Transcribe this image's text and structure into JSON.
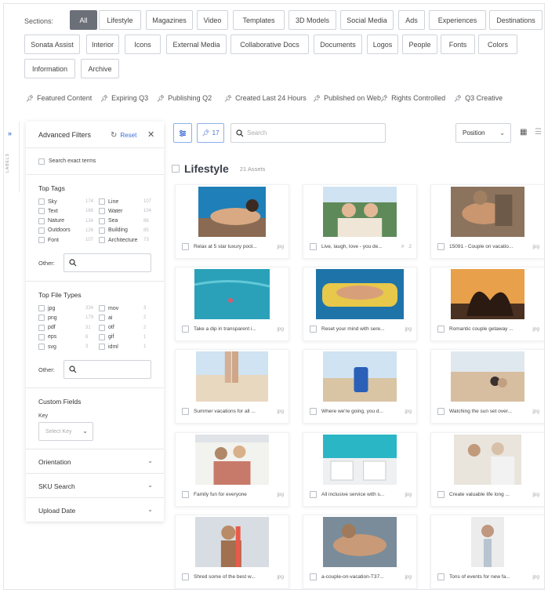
{
  "sections": {
    "label": "Sections:",
    "chips": [
      "All",
      "Lifestyle",
      "Magazines",
      "Video",
      "Templates",
      "3D Models",
      "Social Media",
      "Ads",
      "Experiences",
      "Destinations",
      "Sonata Assist",
      "Interior",
      "Icons",
      "External Media",
      "Collaborative Docs",
      "Documents",
      "Logos",
      "People",
      "Fonts",
      "Colors",
      "Information",
      "Archive"
    ]
  },
  "quick_filters": [
    "Featured Content",
    "Expiring Q3",
    "Publishing Q2",
    "Created Last 24 Hours",
    "Published on Web",
    "Rights Controlled",
    "Q3 Creative"
  ],
  "side_strip": {
    "label": "LABELS"
  },
  "filters": {
    "title": "Advanced Filters",
    "reset": "Reset",
    "exact": "Search exact terms",
    "top_tags": {
      "title": "Top Tags",
      "items": [
        {
          "name": "Sky",
          "count": "174"
        },
        {
          "name": "Line",
          "count": "107"
        },
        {
          "name": "Text",
          "count": "168"
        },
        {
          "name": "Water",
          "count": "104"
        },
        {
          "name": "Nature",
          "count": "134"
        },
        {
          "name": "Sea",
          "count": "86"
        },
        {
          "name": "Outdoors",
          "count": "126"
        },
        {
          "name": "Building",
          "count": "85"
        },
        {
          "name": "Font",
          "count": "107"
        },
        {
          "name": "Architecture",
          "count": "73"
        }
      ],
      "other": "Other:"
    },
    "file_types": {
      "title": "Top File Types",
      "items": [
        {
          "name": "jpg",
          "count": "334"
        },
        {
          "name": "mov",
          "count": "3"
        },
        {
          "name": "png",
          "count": "179"
        },
        {
          "name": "ai",
          "count": "2"
        },
        {
          "name": "pdf",
          "count": "31"
        },
        {
          "name": "otf",
          "count": "2"
        },
        {
          "name": "eps",
          "count": "6"
        },
        {
          "name": "gif",
          "count": "1"
        },
        {
          "name": "svg",
          "count": "3"
        },
        {
          "name": "idml",
          "count": "1"
        }
      ],
      "other": "Other:"
    },
    "custom_fields": {
      "title": "Custom Fields",
      "key_label": "Key",
      "key_placeholder": "Select Key"
    },
    "collapsed": [
      "Orientation",
      "SKU Search",
      "Upload Date"
    ]
  },
  "toolbar": {
    "label_count": "17",
    "search_placeholder": "Search",
    "sort": "Position"
  },
  "heading": {
    "title": "Lifestyle",
    "count": "21 Assets"
  },
  "cards": [
    {
      "name": "Relax at 5 star luxury pool...",
      "ext": "jpg",
      "extra": "",
      "scene": "pool"
    },
    {
      "name": "Live, laugh, love - you de...",
      "ext": "",
      "extra": "2",
      "scene": "friends"
    },
    {
      "name": "15091 - Couple on vacatio...",
      "ext": "jpg",
      "extra": "",
      "scene": "couple"
    },
    {
      "name": "Take a dip in transparent i...",
      "ext": "jpg",
      "extra": "",
      "scene": "water"
    },
    {
      "name": "Reset your mind with sere...",
      "ext": "jpg",
      "extra": "",
      "scene": "float"
    },
    {
      "name": "Romantic couple getaway ...",
      "ext": "jpg",
      "extra": "",
      "scene": "sunset"
    },
    {
      "name": "Summer vacations for all ...",
      "ext": "jpg",
      "extra": "",
      "scene": "beach"
    },
    {
      "name": "Where we're going, you d...",
      "ext": "jpg",
      "extra": "",
      "scene": "luggage"
    },
    {
      "name": "Watching the sun set over...",
      "ext": "jpg",
      "extra": "",
      "scene": "sand"
    },
    {
      "name": "Family fun for everyone",
      "ext": "jpg",
      "extra": "",
      "scene": "family"
    },
    {
      "name": "All inclusive service with s...",
      "ext": "jpg",
      "extra": "",
      "scene": "loungers"
    },
    {
      "name": "Create valuable life long ...",
      "ext": "jpg",
      "extra": "",
      "scene": "elder"
    },
    {
      "name": "Shred some of the best w...",
      "ext": "jpg",
      "extra": "",
      "scene": "surf"
    },
    {
      "name": "a-couple-on-vacation-T37...",
      "ext": "jpg",
      "extra": "",
      "scene": "couple2"
    },
    {
      "name": "Tons of events for new fa...",
      "ext": "jpg",
      "extra": "",
      "scene": "portrait"
    }
  ]
}
